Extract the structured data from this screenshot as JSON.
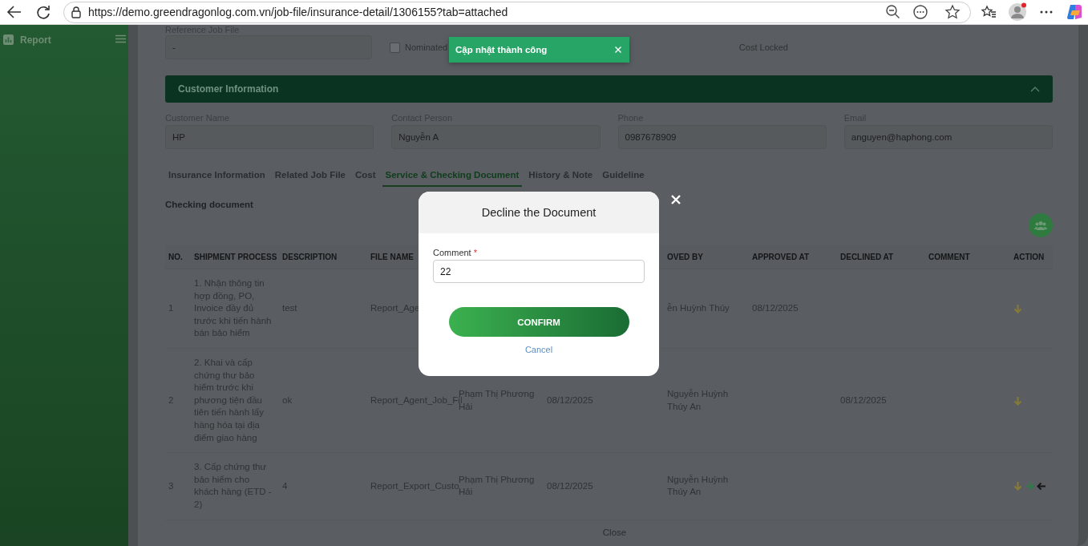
{
  "browser": {
    "url": "https://demo.greendragonlog.com.vn/job-file/insurance-detail/1306155?tab=attached"
  },
  "sidebar": {
    "title": "Report"
  },
  "toast": {
    "message": "Cập nhật thành công"
  },
  "job_file": {
    "label": "Reference Job File",
    "value": "-"
  },
  "checkboxes": [
    {
      "label": "Nominated",
      "checked": false
    }
  ],
  "cost_locked_label": "Cost Locked",
  "customer_section": {
    "title": "Customer Information",
    "expanded": true
  },
  "customer_fields": [
    {
      "label": "Customer Name",
      "value": "HP"
    },
    {
      "label": "Contact Person",
      "value": "Nguyễn A"
    },
    {
      "label": "Phone",
      "value": "0987678909"
    },
    {
      "label": "Email",
      "value": "anguyen@haphong.com"
    }
  ],
  "tabs": [
    {
      "label": "Insurance Information",
      "selected": false
    },
    {
      "label": "Related Job File",
      "selected": false
    },
    {
      "label": "Cost",
      "selected": false
    },
    {
      "label": "Service & Checking Document",
      "selected": true
    },
    {
      "label": "History & Note",
      "selected": false
    },
    {
      "label": "Guideline",
      "selected": false
    }
  ],
  "checking": {
    "title": "Checking document",
    "columns": {
      "no": "NO.",
      "shipment_process": "SHIPMENT PROCESS",
      "description": "DESCRIPTION",
      "file_name": "FILE NAME",
      "approved_by": "OVED BY",
      "approved_at": "APPROVED AT",
      "declined_at": "DECLINED AT",
      "comment": "COMMENT",
      "action": "ACTION"
    },
    "rows": [
      {
        "no": "1",
        "shipment_process": "1. Nhận thông tin hợp đồng, PO, Invoice đầy đủ trước khi tiến hành bán bảo hiểm",
        "description": "test",
        "file_name": "Report_Age",
        "approved_by": "ễn Huỳnh Thúy",
        "approved_at": "08/12/2025",
        "actions": [
          {
            "kind": "down-arrow"
          }
        ]
      },
      {
        "no": "2",
        "shipment_process": "2. Khai và cấp chứng thư bảo hiểm trước khi phương tiện đầu tiên tiến hành lấy hàng hóa tại địa điểm giao hàng",
        "description": "ok",
        "file_name": "Report_Agent_Job_Fil",
        "column_5": "Phạm Thị Phương Hải",
        "column_6": "08/12/2025",
        "approved_by": "Nguyễn Huỳnh Thúy An",
        "declined_at": "08/12/2025",
        "actions": [
          {
            "kind": "down-arrow"
          }
        ]
      },
      {
        "no": "3",
        "shipment_process": "3. Cấp chứng thư bảo hiểm cho khách hàng (ETD - 2)",
        "description": "4",
        "file_name": "Report_Export_Custo",
        "column_5": "Phạm Thị Phương Hải",
        "column_6": "08/12/2025",
        "approved_by": "Nguyễn Huỳnh Thúy An",
        "actions": [
          {
            "kind": "down-arrow"
          },
          {
            "kind": "right-arrow"
          },
          {
            "kind": "left-arrow"
          }
        ]
      }
    ],
    "close": "Close"
  },
  "modal": {
    "title": "Decline the Document",
    "field_label": "Comment",
    "required_mark": "*",
    "value": "22",
    "confirm": "CONFIRM",
    "cancel": "Cancel"
  }
}
